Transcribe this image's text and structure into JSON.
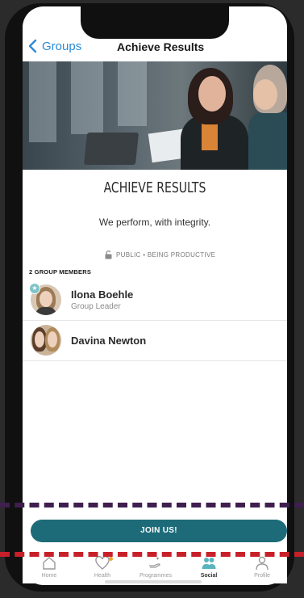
{
  "nav": {
    "back_label": "Groups",
    "title": "Achieve Results"
  },
  "group": {
    "title": "ACHIEVE RESULTS",
    "description": "We perform, with integrity.",
    "meta": "PUBLIC • BEING PRODUCTIVE",
    "members_count_label": "2 GROUP MEMBERS"
  },
  "members": [
    {
      "name": "Ilona  Boehle",
      "role": "Group Leader"
    },
    {
      "name": "Davina  Newton"
    }
  ],
  "join_button_label": "JOIN US!",
  "tabs": [
    {
      "label": "Home",
      "icon": "home-icon"
    },
    {
      "label": "Health",
      "icon": "heart-icon"
    },
    {
      "label": "Programmes",
      "icon": "hand-icon"
    },
    {
      "label": "Social",
      "icon": "people-icon",
      "active": true
    },
    {
      "label": "Profile",
      "icon": "person-icon"
    }
  ],
  "colors": {
    "accent": "#1d6b78",
    "link": "#2b8ad6",
    "social_active": "#5ab4bd",
    "health_dot": "#f0a030",
    "dash_purple": "#3e1f4f",
    "dash_red": "#c8202a"
  }
}
